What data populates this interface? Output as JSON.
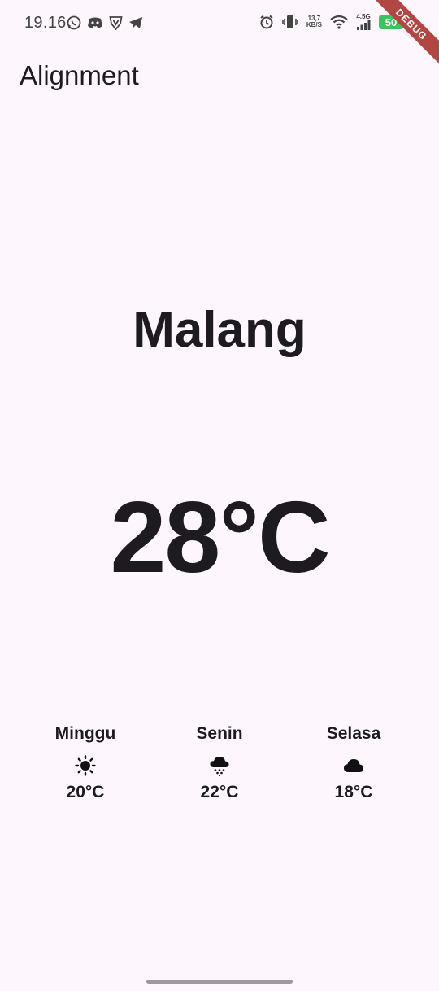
{
  "status_bar": {
    "time": "19.16",
    "net_speed_top": "13,7",
    "net_speed_bottom": "KB/S",
    "network_type": "4.5G",
    "battery_level": "50"
  },
  "debug_banner": {
    "label": "DEBUG",
    "color": "#b14642"
  },
  "app_bar": {
    "title": "Alignment"
  },
  "weather": {
    "city": "Malang",
    "current_temp": "28°C",
    "forecast": [
      {
        "day": "Minggu",
        "icon": "sunny-icon",
        "temp": "20°C"
      },
      {
        "day": "Senin",
        "icon": "snow-cloud-icon",
        "temp": "22°C"
      },
      {
        "day": "Selasa",
        "icon": "cloud-icon",
        "temp": "18°C"
      }
    ]
  }
}
